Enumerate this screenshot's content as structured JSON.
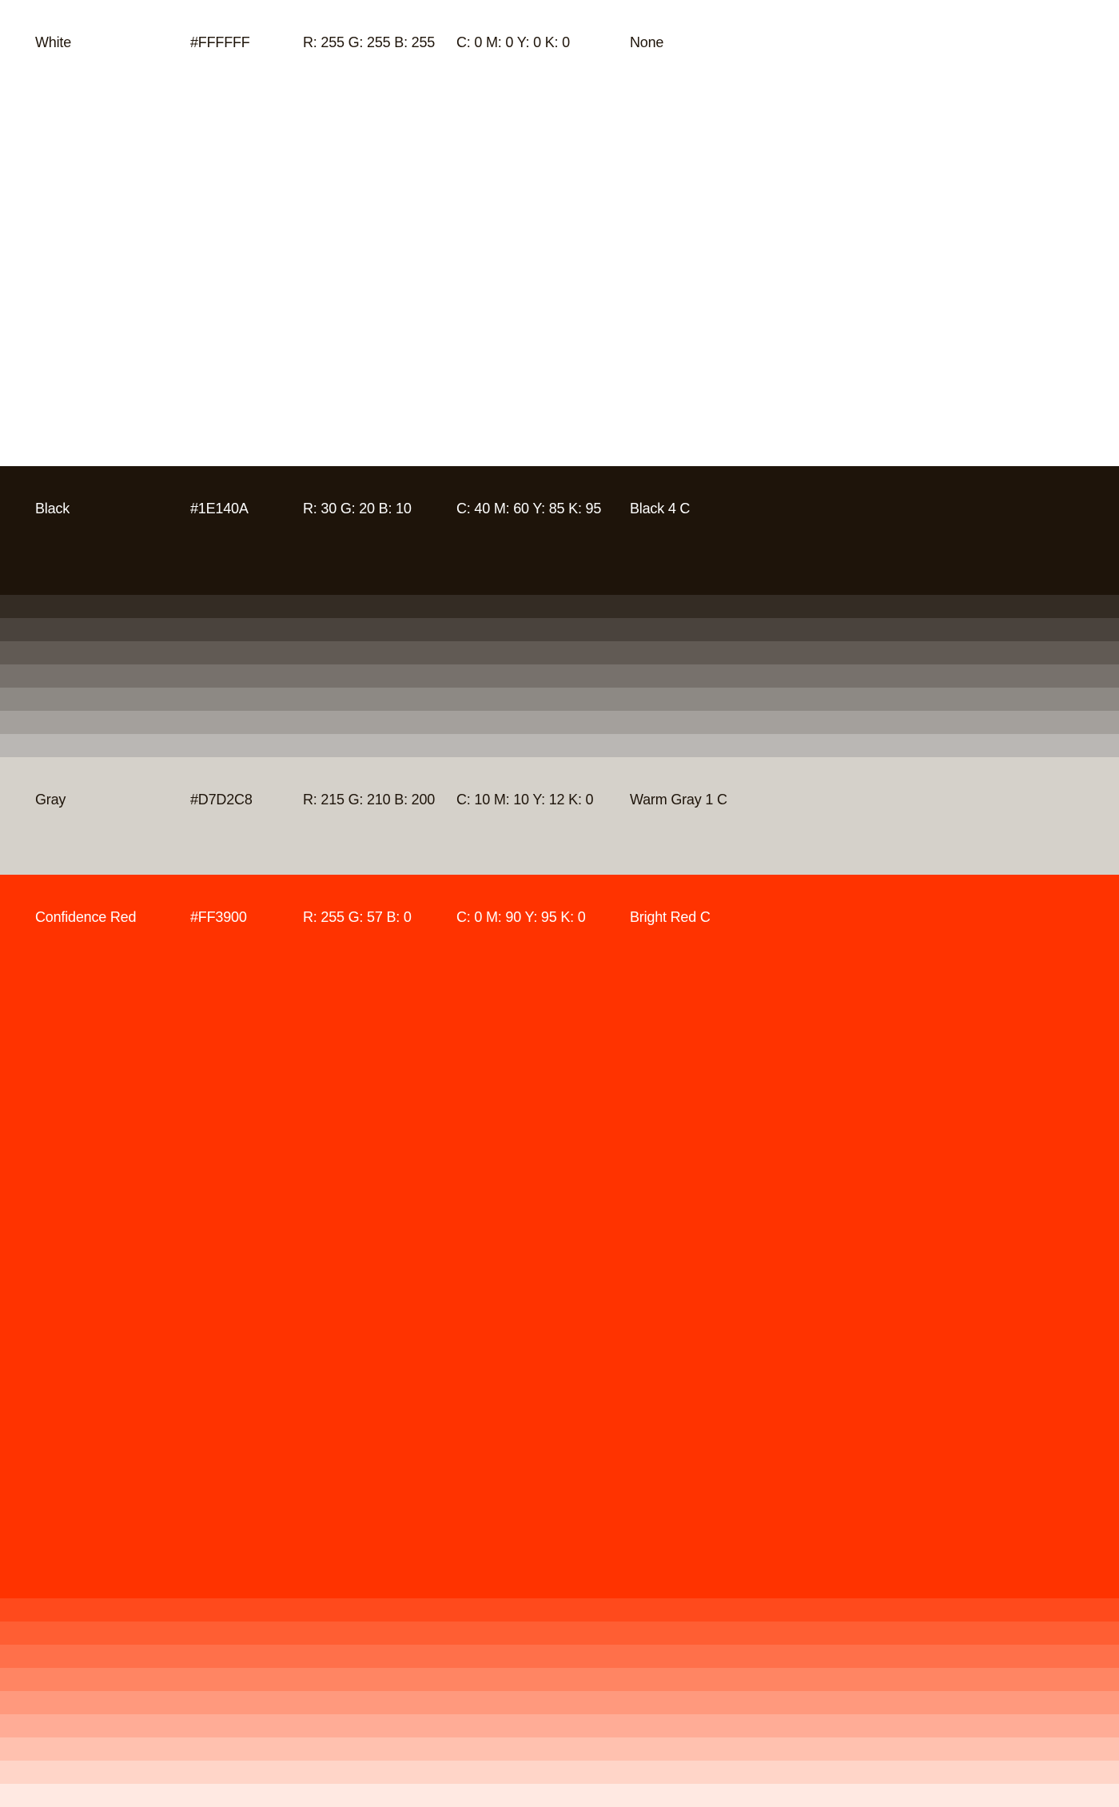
{
  "swatches": {
    "white": {
      "name": "White",
      "hex": "#FFFFFF",
      "rgb": "R: 255 G: 255 B: 255",
      "cmyk": "C: 0 M: 0 Y: 0 K: 0",
      "pms": "None"
    },
    "black": {
      "name": "Black",
      "hex": "#1E140A",
      "rgb": "R: 30 G: 20 B: 10",
      "cmyk": "C: 40 M: 60 Y: 85 K: 95",
      "pms": "Black 4 C"
    },
    "gray": {
      "name": "Gray",
      "hex": "#D7D2C8",
      "rgb": "R: 215 G: 210 B: 200",
      "cmyk": "C: 10 M: 10 Y: 12 K: 0",
      "pms": "Warm Gray 1 C"
    },
    "red": {
      "name": "Confidence Red",
      "hex": "#FF3900",
      "rgb": "R: 255 G: 57 B: 0",
      "cmyk": "C: 0 M: 90 Y: 95 K: 0",
      "pms": "Bright Red C"
    }
  },
  "black_tints": [
    "#342C24",
    "#4A433D",
    "#615A54",
    "#77716C",
    "#8D8984",
    "#A4A09C",
    "#BAB7B4"
  ],
  "red_tints": [
    "#FF4A1C",
    "#FF5E33",
    "#FF704A",
    "#FF8563",
    "#FF997D",
    "#FFAC96",
    "#FFC1AF",
    "#FFD5C8",
    "#FFE9E2"
  ]
}
